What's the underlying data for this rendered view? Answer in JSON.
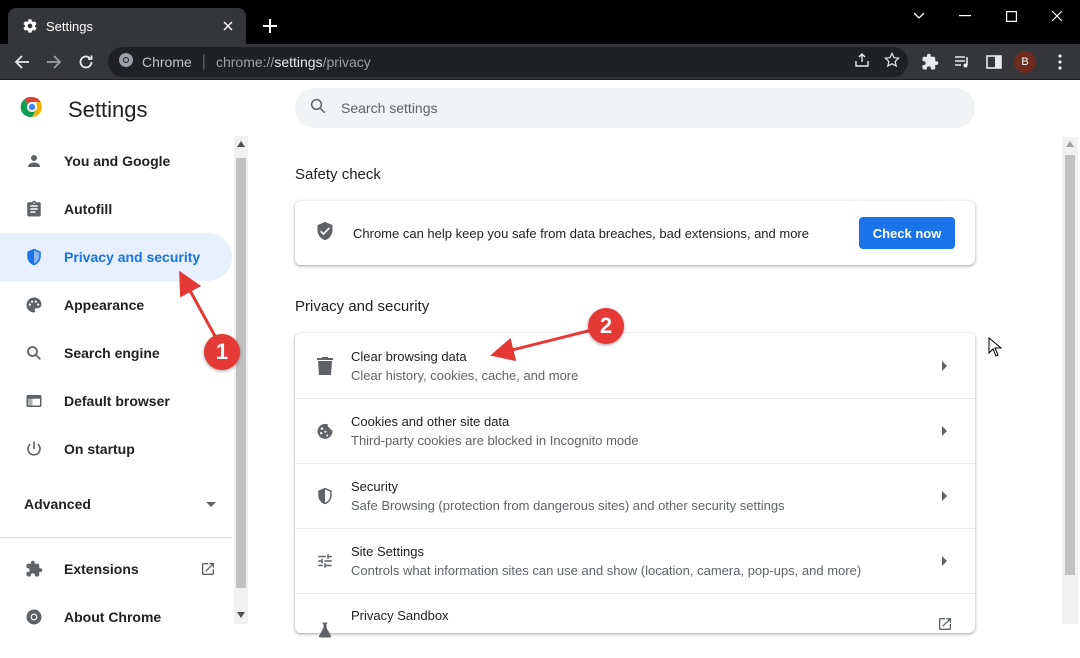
{
  "browser": {
    "tab_title": "Settings",
    "omnibox_site_label": "Chrome",
    "omnibox_url_prefix": "chrome://",
    "omnibox_url_host": "settings",
    "omnibox_url_path": "/privacy",
    "profile_initial": "B"
  },
  "settings": {
    "title": "Settings",
    "search_placeholder": "Search settings"
  },
  "sidebar": {
    "items": [
      {
        "label": "You and Google",
        "icon": "person-icon"
      },
      {
        "label": "Autofill",
        "icon": "clipboard-icon"
      },
      {
        "label": "Privacy and security",
        "icon": "shield-icon",
        "active": true
      },
      {
        "label": "Appearance",
        "icon": "palette-icon"
      },
      {
        "label": "Search engine",
        "icon": "search-icon"
      },
      {
        "label": "Default browser",
        "icon": "browser-icon"
      },
      {
        "label": "On startup",
        "icon": "power-icon"
      }
    ],
    "advanced_label": "Advanced",
    "extensions_label": "Extensions",
    "about_label": "About Chrome"
  },
  "safety_check": {
    "section_title": "Safety check",
    "text": "Chrome can help keep you safe from data breaches, bad extensions, and more",
    "button_label": "Check now"
  },
  "privacy": {
    "section_title": "Privacy and security",
    "rows": [
      {
        "title": "Clear browsing data",
        "subtitle": "Clear history, cookies, cache, and more",
        "icon": "trash-icon"
      },
      {
        "title": "Cookies and other site data",
        "subtitle": "Third-party cookies are blocked in Incognito mode",
        "icon": "cookie-icon"
      },
      {
        "title": "Security",
        "subtitle": "Safe Browsing (protection from dangerous sites) and other security settings",
        "icon": "shield-icon"
      },
      {
        "title": "Site Settings",
        "subtitle": "Controls what information sites can use and show (location, camera, pop-ups, and more)",
        "icon": "tune-icon"
      },
      {
        "title": "Privacy Sandbox",
        "subtitle": "",
        "icon": "flask-icon"
      }
    ]
  },
  "annotations": {
    "badge_1": "1",
    "badge_2": "2",
    "color": "#e53935"
  },
  "colors": {
    "accent": "#1a73e8",
    "active_bg": "#e8f0fe"
  }
}
